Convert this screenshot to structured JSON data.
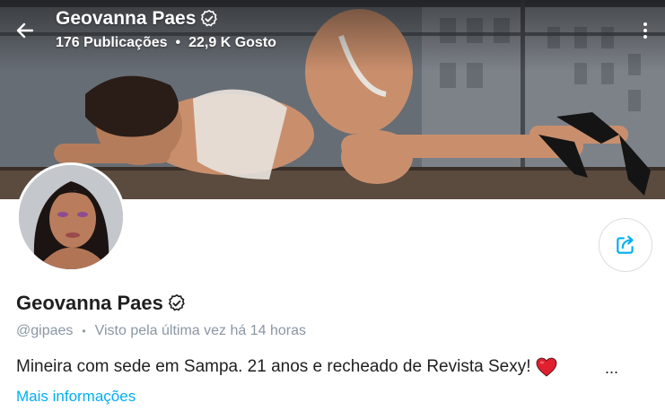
{
  "header": {
    "title": "Geovanna Paes",
    "posts_count": "176 Publicações",
    "likes_count": "22,9 K Gosto",
    "separator": "•"
  },
  "profile": {
    "name": "Geovanna Paes",
    "handle": "@gipaes",
    "separator": "•",
    "last_seen": "Visto pela última vez há 14 horas",
    "bio": "Mineira com sede em Sampa. 21 anos e recheado de Revista Sexy!",
    "bio_more": "...",
    "more_info": "Mais informações"
  },
  "colors": {
    "accent": "#00aff0",
    "muted": "#8a96a3",
    "heart": "#e0202f"
  },
  "icons": {
    "back": "arrow-left-icon",
    "verified": "verified-badge-icon",
    "more": "more-vertical-icon",
    "share": "share-icon",
    "heart": "heart-icon"
  }
}
